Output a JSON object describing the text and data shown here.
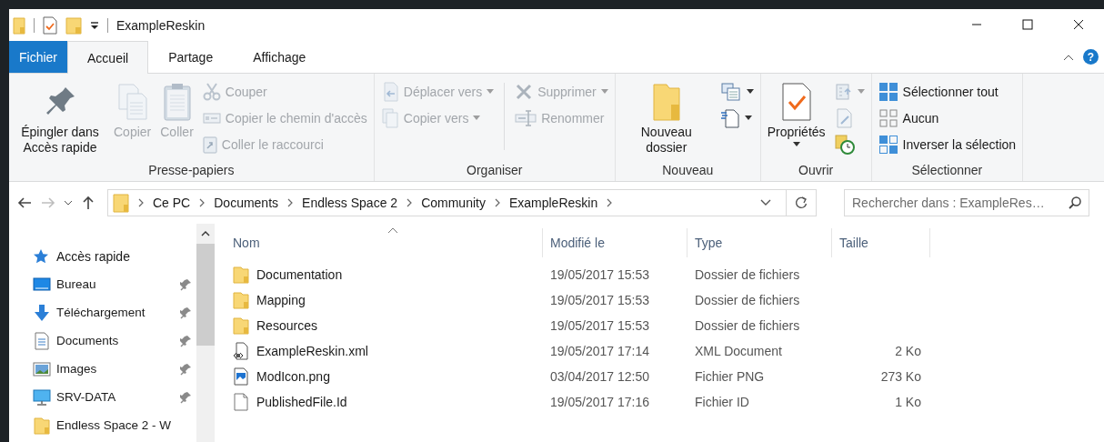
{
  "window": {
    "title": "ExampleReskin"
  },
  "ribbon_tabs": [
    {
      "label": "Fichier",
      "kind": "file",
      "selected": false
    },
    {
      "label": "Accueil",
      "kind": "tab",
      "selected": true
    },
    {
      "label": "Partage",
      "kind": "tab",
      "selected": false
    },
    {
      "label": "Affichage",
      "kind": "tab",
      "selected": false
    }
  ],
  "help": "?",
  "ribbon": {
    "groups": [
      {
        "label": "Presse-papiers",
        "columns": [
          {
            "kind": "large",
            "items": [
              {
                "label": "Épingler dans Accès rapide",
                "disabled": false,
                "dropdown": false
              }
            ]
          },
          {
            "kind": "large",
            "items": [
              {
                "label": "Copier",
                "disabled": true,
                "dropdown": false
              }
            ]
          },
          {
            "kind": "large",
            "items": [
              {
                "label": "Coller",
                "disabled": true,
                "dropdown": false
              }
            ]
          },
          {
            "kind": "small",
            "items": [
              {
                "label": "Couper",
                "disabled": true,
                "dropdown": false
              },
              {
                "label": "Copier le chemin d'accès",
                "disabled": true,
                "dropdown": false
              },
              {
                "label": "Coller le raccourci",
                "disabled": true,
                "dropdown": false
              }
            ]
          }
        ]
      },
      {
        "label": "Organiser",
        "columns": [
          {
            "kind": "small",
            "items": [
              {
                "label": "Déplacer vers",
                "disabled": true,
                "dropdown": true
              },
              {
                "label": "Copier vers",
                "disabled": true,
                "dropdown": true
              }
            ]
          },
          {
            "kind": "small",
            "items": [
              {
                "label": "Supprimer",
                "disabled": true,
                "dropdown": true
              },
              {
                "label": "Renommer",
                "disabled": true,
                "dropdown": false
              }
            ]
          }
        ]
      },
      {
        "label": "Nouveau",
        "columns": [
          {
            "kind": "large",
            "items": [
              {
                "label": "Nouveau dossier",
                "disabled": false,
                "dropdown": false
              }
            ]
          },
          {
            "kind": "small",
            "items": [
              {
                "disabled": false,
                "dropdown": true
              },
              {
                "disabled": false,
                "dropdown": true
              }
            ]
          }
        ]
      },
      {
        "label": "Ouvrir",
        "columns": [
          {
            "kind": "large",
            "items": [
              {
                "label": "Propriétés",
                "disabled": false,
                "dropdown": true
              }
            ]
          },
          {
            "kind": "small",
            "items": [
              {
                "disabled": true,
                "dropdown": true
              },
              {
                "disabled": true,
                "dropdown": false
              },
              {
                "disabled": false,
                "dropdown": false
              }
            ]
          }
        ]
      },
      {
        "label": "Sélectionner",
        "columns": [
          {
            "kind": "small",
            "items": [
              {
                "label": "Sélectionner tout",
                "disabled": false,
                "dropdown": false
              },
              {
                "label": "Aucun",
                "disabled": false,
                "dropdown": false
              },
              {
                "label": "Inverser la sélection",
                "disabled": false,
                "dropdown": false
              }
            ]
          }
        ]
      }
    ]
  },
  "navigation": {
    "forward_disabled": true
  },
  "breadcrumb": [
    "Ce PC",
    "Documents",
    "Endless Space 2",
    "Community",
    "ExampleReskin"
  ],
  "search": {
    "placeholder": "Rechercher dans : ExampleRes…"
  },
  "sidebar": {
    "header": "Accès rapide",
    "items": [
      {
        "label": "Bureau",
        "pinned": true
      },
      {
        "label": "Téléchargement",
        "pinned": true
      },
      {
        "label": "Documents",
        "pinned": true
      },
      {
        "label": "Images",
        "pinned": true
      },
      {
        "label": "SRV-DATA",
        "pinned": true
      },
      {
        "label": "Endless Space 2 - W",
        "pinned": false
      }
    ]
  },
  "table": {
    "columns": [
      "Nom",
      "Modifié le",
      "Type",
      "Taille"
    ],
    "rows": [
      {
        "kind": "folder",
        "name": "Documentation",
        "modified": "19/05/2017 15:53",
        "type": "Dossier de fichiers"
      },
      {
        "kind": "folder",
        "name": "Mapping",
        "modified": "19/05/2017 15:53",
        "type": "Dossier de fichiers"
      },
      {
        "kind": "folder",
        "name": "Resources",
        "modified": "19/05/2017 15:53",
        "type": "Dossier de fichiers"
      },
      {
        "kind": "xml",
        "name": "ExampleReskin.xml",
        "modified": "19/05/2017 17:14",
        "type": "XML Document",
        "size": "2 Ko"
      },
      {
        "kind": "image",
        "name": "ModIcon.png",
        "modified": "03/04/2017 12:50",
        "type": "Fichier PNG",
        "size": "273 Ko"
      },
      {
        "kind": "file",
        "name": "PublishedFile.Id",
        "modified": "19/05/2017 17:16",
        "type": "Fichier ID",
        "size": "1 Ko"
      }
    ]
  }
}
